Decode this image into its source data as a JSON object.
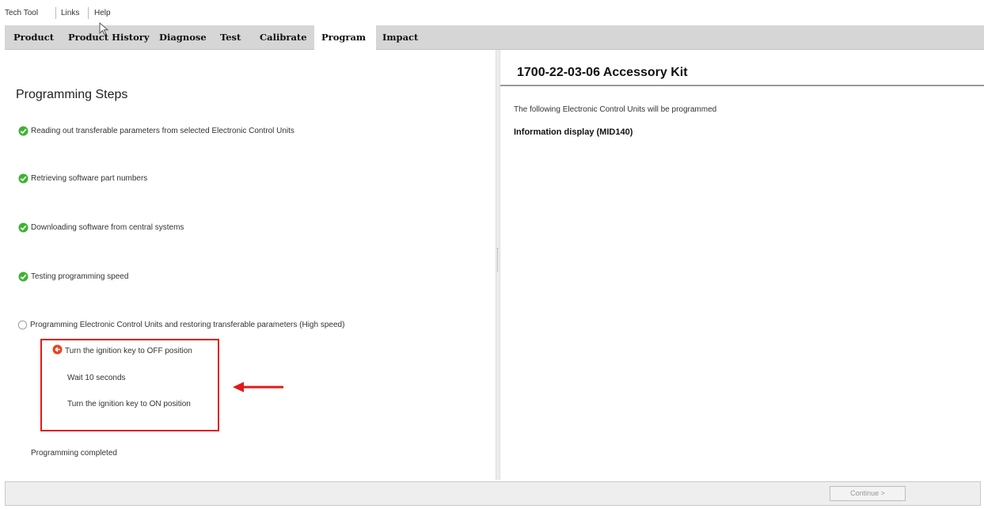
{
  "menu": {
    "items": [
      "Tech Tool",
      "Links",
      "Help"
    ]
  },
  "tabs": [
    {
      "label": "Product"
    },
    {
      "label": "Product History"
    },
    {
      "label": "Diagnose"
    },
    {
      "label": "Test"
    },
    {
      "label": "Calibrate"
    },
    {
      "label": "Program"
    },
    {
      "label": "Impact"
    }
  ],
  "active_tab": "Program",
  "left": {
    "title": "Programming Steps",
    "steps": [
      {
        "label": "Reading out transferable parameters from selected Electronic Control Units",
        "status": "done"
      },
      {
        "label": "Retrieving software part numbers",
        "status": "done"
      },
      {
        "label": "Downloading software from central systems",
        "status": "done"
      },
      {
        "label": "Testing programming speed",
        "status": "done"
      },
      {
        "label": "Programming Electronic Control Units and restoring transferable parameters (High speed)",
        "status": "pending"
      }
    ],
    "substeps": [
      {
        "label": "Turn the ignition key to OFF position",
        "status": "action"
      },
      {
        "label": "Wait 10 seconds",
        "status": "none"
      },
      {
        "label": "Turn the ignition key to ON position",
        "status": "none"
      }
    ],
    "completed_label": "Programming completed"
  },
  "right": {
    "title": "1700-22-03-06 Accessory Kit",
    "subtitle": "The following Electronic Control Units will be programmed",
    "ecu": "Information display (MID140)"
  },
  "footer": {
    "continue_label": "Continue >"
  },
  "colors": {
    "highlight": "#e01a1a",
    "check_green": "#3bb42f",
    "tab_bar": "#d6d6d6"
  }
}
